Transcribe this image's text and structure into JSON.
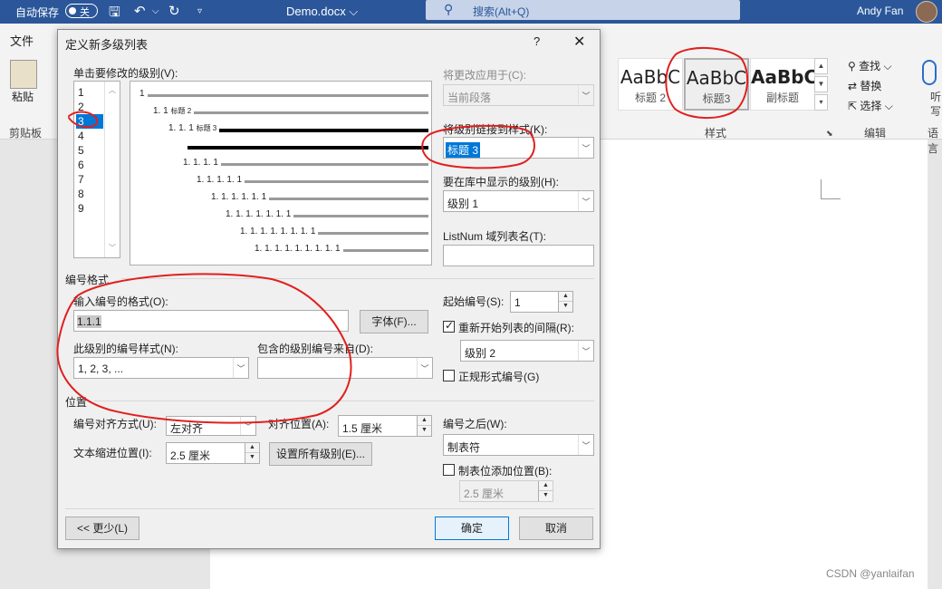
{
  "titlebar": {
    "autosave_label": "自动保存",
    "autosave_state": "关",
    "doc_name": "Demo.docx ⌵",
    "search_placeholder": "搜索(Alt+Q)",
    "user_name": "Andy Fan"
  },
  "ribbon": {
    "file_tab": "文件",
    "paste_label": "粘贴",
    "clipboard_group": "剪贴板",
    "styles": [
      {
        "sample": "AaBbC",
        "name": "标题 2"
      },
      {
        "sample": "AaBbC",
        "name": "标题3"
      },
      {
        "sample": "AaBbC",
        "name": "副标题"
      }
    ],
    "styles_group": "样式",
    "find_label": "查找",
    "replace_label": "替换",
    "select_label": "选择",
    "editing_group": "编辑",
    "voice_label": "听",
    "voice_label2": "写",
    "voice_group": "语言"
  },
  "dialog": {
    "title": "定义新多级列表",
    "help": "?",
    "close": "✕",
    "level_prompt": "单击要修改的级别(V):",
    "levels": [
      "1",
      "2",
      "3",
      "4",
      "5",
      "6",
      "7",
      "8",
      "9"
    ],
    "selected_level": "3",
    "preview": [
      {
        "num": "1",
        "style": ""
      },
      {
        "num": "1. 1",
        "style": "标题 2"
      },
      {
        "num": "1. 1. 1",
        "style": "标题 3"
      },
      {
        "num": "",
        "style": ""
      },
      {
        "num": "1. 1. 1. 1",
        "style": ""
      },
      {
        "num": "1. 1. 1. 1. 1",
        "style": ""
      },
      {
        "num": "1. 1. 1. 1. 1. 1",
        "style": ""
      },
      {
        "num": "1. 1. 1. 1. 1. 1. 1",
        "style": ""
      },
      {
        "num": "1. 1. 1. 1. 1. 1. 1. 1",
        "style": ""
      },
      {
        "num": "1. 1. 1. 1. 1. 1. 1. 1. 1",
        "style": ""
      }
    ],
    "apply_to_label": "将更改应用于(C):",
    "apply_to_value": "当前段落",
    "link_style_label": "将级别链接到样式(K):",
    "link_style_value": "标题 3",
    "gallery_level_label": "要在库中显示的级别(H):",
    "gallery_level_value": "级别 1",
    "listnum_label": "ListNum 域列表名(T):",
    "listnum_value": "",
    "number_format_section": "编号格式",
    "enter_format_label": "输入编号的格式(O):",
    "format_value": "1.1.1",
    "font_button": "字体(F)...",
    "number_style_label": "此级别的编号样式(N):",
    "number_style_value": "1, 2, 3, ...",
    "include_from_label": "包含的级别编号来自(D):",
    "include_from_value": "",
    "start_at_label": "起始编号(S):",
    "start_at_value": "1",
    "restart_label": "重新开始列表的间隔(R):",
    "restart_value": "级别 2",
    "legal_label": "正规形式编号(G)",
    "position_section": "位置",
    "alignment_label": "编号对齐方式(U):",
    "alignment_value": "左对齐",
    "aligned_at_label": "对齐位置(A):",
    "aligned_at_value": "1.5 厘米",
    "indent_label": "文本缩进位置(I):",
    "indent_value": "2.5 厘米",
    "set_all_button": "设置所有级别(E)...",
    "follow_label": "编号之后(W):",
    "follow_value": "制表符",
    "tab_stop_label": "制表位添加位置(B):",
    "tab_stop_value": "2.5 厘米",
    "less_button": "<< 更少(L)",
    "ok_button": "确定",
    "cancel_button": "取消"
  },
  "watermark": "CSDN @yanlaifan",
  "colors": {
    "accent": "#2b579a",
    "selection": "#0078d7",
    "annotation": "#e0201e"
  }
}
